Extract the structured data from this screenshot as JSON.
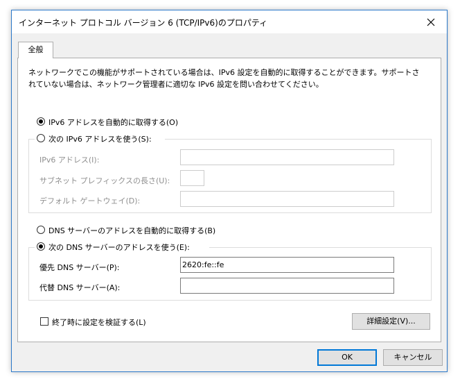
{
  "window": {
    "title": "インターネット プロトコル バージョン 6 (TCP/IPv6)のプロパティ",
    "close_icon": "close-icon"
  },
  "tabs": [
    {
      "label": "全般",
      "selected": true
    }
  ],
  "description": "ネットワークでこの機能がサポートされている場合は、IPv6 設定を自動的に取得することができます。サポートされていない場合は、ネットワーク管理者に適切な IPv6 設定を問い合わせてください。",
  "ip_section": {
    "auto_label": "IPv6 アドレスを自動的に取得する(O)",
    "auto_selected": true,
    "manual_label": "次の IPv6 アドレスを使う(S):",
    "manual_selected": false,
    "fields": {
      "address_label": "IPv6 アドレス(I):",
      "address_value": "",
      "prefix_label": "サブネット プレフィックスの長さ(U):",
      "prefix_value": "",
      "gateway_label": "デフォルト ゲートウェイ(D):",
      "gateway_value": ""
    }
  },
  "dns_section": {
    "auto_label": "DNS サーバーのアドレスを自動的に取得する(B)",
    "auto_selected": false,
    "manual_label": "次の DNS サーバーのアドレスを使う(E):",
    "manual_selected": true,
    "fields": {
      "preferred_label": "優先 DNS サーバー(P):",
      "preferred_value": "2620:fe::fe",
      "alternate_label": "代替 DNS サーバー(A):",
      "alternate_value": ""
    }
  },
  "validate": {
    "label": "終了時に設定を検証する(L)",
    "checked": false
  },
  "buttons": {
    "advanced": "詳細設定(V)...",
    "ok": "OK",
    "cancel": "キャンセル"
  }
}
